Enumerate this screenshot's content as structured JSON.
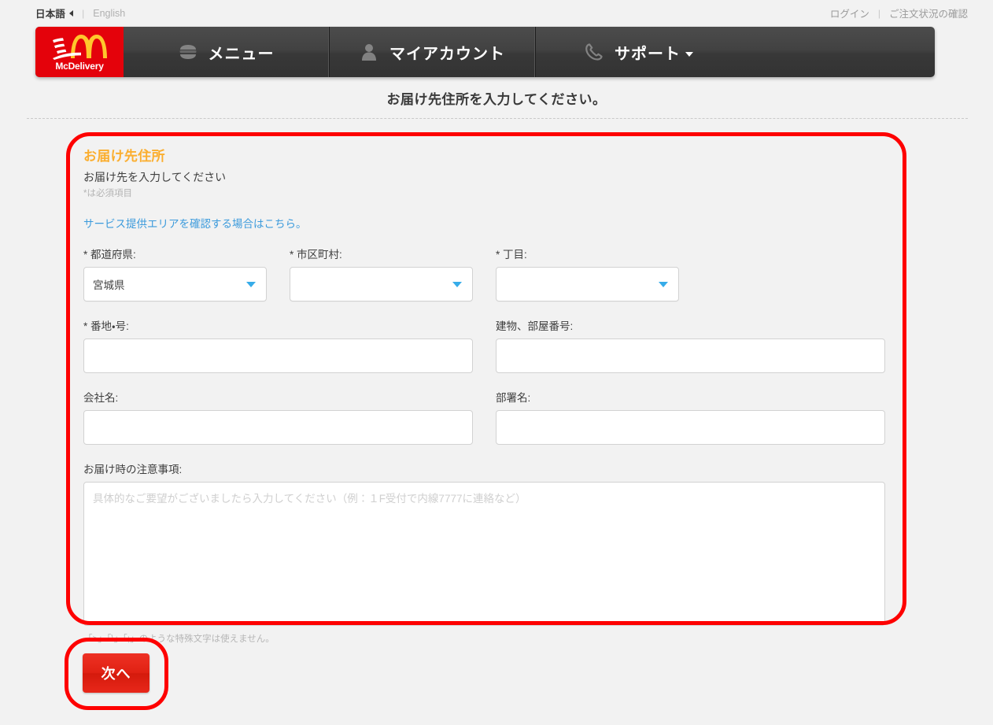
{
  "utility_bar": {
    "lang_ja": "日本語",
    "lang_en": "English",
    "separator": "|",
    "login": "ログイン",
    "order_status": "ご注文状況の確認"
  },
  "header": {
    "logo_text": "McDelivery",
    "nav": [
      {
        "label": "メニュー",
        "icon": "burger-icon"
      },
      {
        "label": "マイアカウント",
        "icon": "person-icon"
      },
      {
        "label": "サポート",
        "icon": "phone-icon",
        "has_caret": true
      }
    ]
  },
  "page": {
    "title": "お届け先住所を入力してください。"
  },
  "form": {
    "section_title": "お届け先住所",
    "section_subtitle": "お届け先を入力してください",
    "required_note": "*は必須項目",
    "area_link": "サービス提供エリアを確認する場合はこちら。",
    "fields": {
      "prefecture": {
        "label": "* 都道府県:",
        "value": "宮城県",
        "placeholder": ""
      },
      "city": {
        "label": "* 市区町村:",
        "value": "",
        "placeholder": ""
      },
      "chome": {
        "label": "* 丁目:",
        "value": "",
        "placeholder": ""
      },
      "banchi": {
        "label": "* 番地・号:",
        "value": "",
        "placeholder": ""
      },
      "building": {
        "label": "建物、部屋番号:",
        "value": "",
        "placeholder": ""
      },
      "company": {
        "label": "会社名:",
        "value": "",
        "placeholder": ""
      },
      "department": {
        "label": "部署名:",
        "value": "",
        "placeholder": ""
      },
      "notes": {
        "label": "お届け時の注意事項:",
        "value": "",
        "placeholder": "具体的なご要望がございましたら入力してください（例：１F受付で内線7777に連絡など）"
      }
    },
    "special_char_note": "「>」「\\」「;」のような特殊文字は使えません。"
  },
  "actions": {
    "next_label": "次へ"
  },
  "colors": {
    "brand_red": "#e4020b",
    "accent_orange": "#fbae2f",
    "link_blue": "#3c9bdc",
    "select_caret_blue": "#36ace9",
    "annotation_red": "#fe0000",
    "nav_dark": "#3c3c3c",
    "page_bg": "#f2f2f2"
  }
}
